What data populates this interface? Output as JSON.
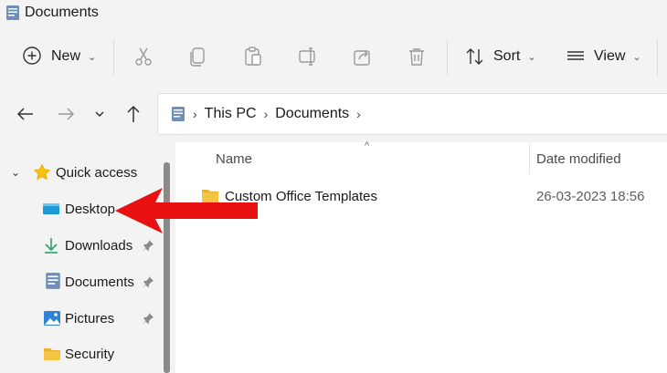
{
  "window": {
    "title": "Documents"
  },
  "toolbar": {
    "new_label": "New",
    "sort_label": "Sort",
    "view_label": "View",
    "buttons": [
      "cut-icon",
      "copy-icon",
      "paste-icon",
      "rename-icon",
      "share-icon",
      "delete-icon"
    ]
  },
  "navigation": {
    "breadcrumb": [
      "This PC",
      "Documents"
    ]
  },
  "sidebar": {
    "quick_access_label": "Quick access",
    "items": [
      {
        "label": "Desktop",
        "pinned": false
      },
      {
        "label": "Downloads",
        "pinned": true
      },
      {
        "label": "Documents",
        "pinned": true
      },
      {
        "label": "Pictures",
        "pinned": true
      },
      {
        "label": "Security",
        "pinned": false
      }
    ]
  },
  "file_list": {
    "columns": [
      "Name",
      "Date modified"
    ],
    "rows": [
      {
        "name": "Custom Office Templates",
        "date_modified": "26-03-2023 18:56"
      }
    ]
  },
  "colors": {
    "annotation_arrow": "#e81010",
    "folder": "#f5c542",
    "accent": "#0067c0"
  }
}
